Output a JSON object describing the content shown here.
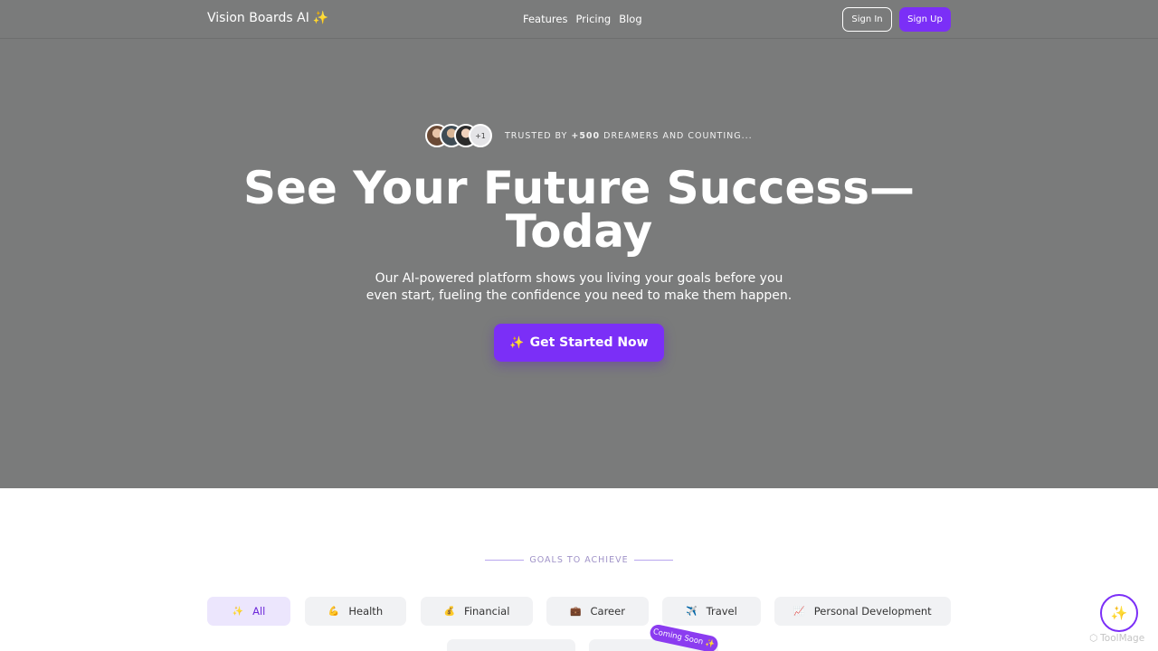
{
  "nav": {
    "brand": "Vision Boards AI",
    "brand_icon": "sparkles-icon",
    "links": [
      "Features",
      "Pricing",
      "Blog"
    ],
    "signin_label": "Sign In",
    "signup_label": "Sign Up"
  },
  "hero": {
    "avatar_more": "+1",
    "trusted_prefix": "TRUSTED BY ",
    "trusted_count": "+500",
    "trusted_suffix": " DREAMERS AND COUNTING...",
    "headline_line1": "See Your Future Success—",
    "headline_line2": "Today",
    "subtext_line1": "Our AI-powered platform shows you living your goals before you",
    "subtext_line2": "even start, fueling the confidence you need to make them happen.",
    "cta_label": "Get Started Now"
  },
  "goals": {
    "heading": "GOALS TO ACHIEVE",
    "categories": [
      {
        "label": "All",
        "icon": "sparkles-icon",
        "glyph": "✨",
        "active": true
      },
      {
        "label": "Health",
        "icon": "flexed-biceps-icon",
        "glyph": "💪",
        "active": false
      },
      {
        "label": "Financial",
        "icon": "money-bag-icon",
        "glyph": "💰",
        "active": false
      },
      {
        "label": "Career",
        "icon": "briefcase-icon",
        "glyph": "💼",
        "active": false
      },
      {
        "label": "Travel",
        "icon": "airplane-icon",
        "glyph": "✈️",
        "active": false
      },
      {
        "label": "Personal Development",
        "icon": "chart-increasing-icon",
        "glyph": "📈",
        "active": false
      }
    ],
    "coming_soon": "Coming Soon ✨"
  },
  "watermark": "ToolMage",
  "colors": {
    "accent": "#7b2ff7",
    "hero_bg": "#7a7b7b",
    "chip_bg": "#f1f2f4",
    "chip_active_bg": "#ece6fd"
  }
}
